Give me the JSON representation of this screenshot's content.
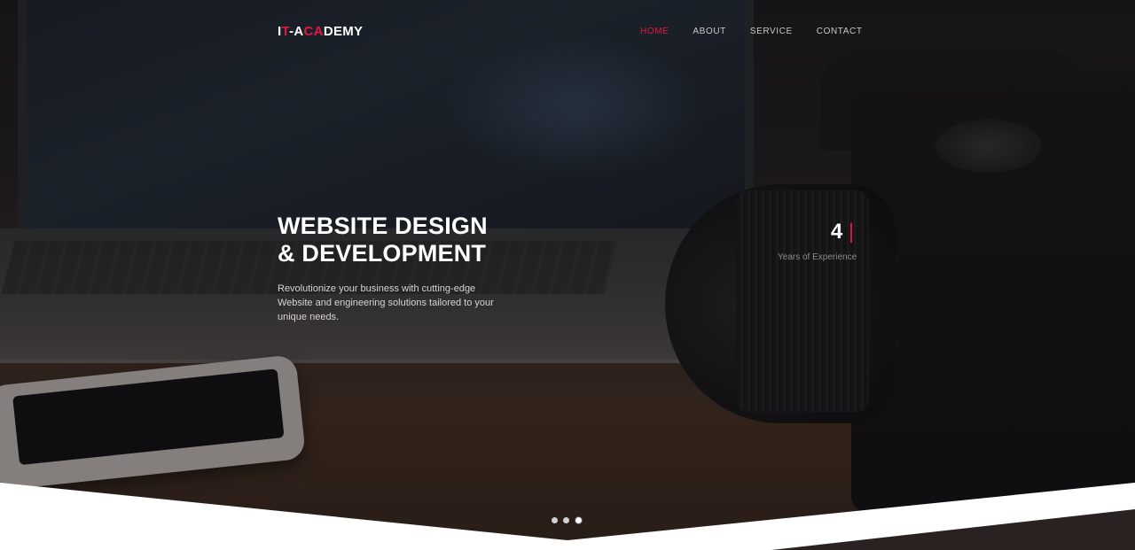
{
  "header": {
    "logo": {
      "part1": "I",
      "part2": "T",
      "part3": "-A",
      "part4": "CA",
      "part5": "DEMY"
    },
    "nav": [
      {
        "label": "HOME",
        "active": true
      },
      {
        "label": "ABOUT",
        "active": false
      },
      {
        "label": "SERVICE",
        "active": false
      },
      {
        "label": "CONTACT",
        "active": false
      }
    ]
  },
  "hero": {
    "title_line1": "WEBSITE DESIGN",
    "title_line2": "& DEVELOPMENT",
    "description": "Revolutionize your business with cutting-edge Website and engineering solutions tailored to your unique needs.",
    "stat_value": "4",
    "stat_cursor": "|",
    "stat_label": "Years of Experience"
  },
  "slider": {
    "count": 3,
    "active_index": 2
  },
  "colors": {
    "accent": "#e2173f",
    "text": "#ffffff",
    "nav": "#c9c9c9"
  }
}
